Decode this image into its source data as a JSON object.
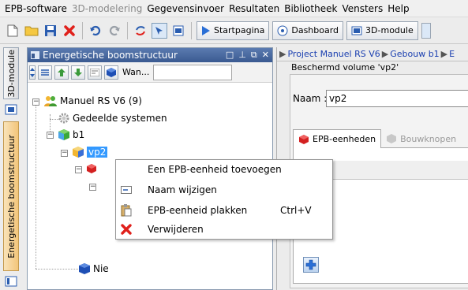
{
  "menubar": {
    "items": [
      {
        "label": "EPB-software"
      },
      {
        "label": "3D-modelering"
      },
      {
        "label": "Gegevensinvoer"
      },
      {
        "label": "Resultaten"
      },
      {
        "label": "Bibliotheek"
      },
      {
        "label": "Vensters"
      },
      {
        "label": "Help"
      }
    ]
  },
  "toolbar": {
    "startpagina_label": "Startpagina",
    "dashboard_label": "Dashboard",
    "module_3d_label": "3D-module"
  },
  "side_tabs": {
    "module_3d": "3D-module",
    "boomstructuur": "Energetische boomstructuur"
  },
  "tree_panel": {
    "title": "Energetische boomstructuur",
    "filter_button_label": "Wan...",
    "nodes": {
      "root": "Manuel RS V6 (9)",
      "systems": "Gedeelde systemen",
      "building": "b1",
      "volume": "vp2",
      "hidden_node": "Nie"
    }
  },
  "right_panel": {
    "breadcrumb": [
      "Project Manuel RS V6",
      "Gebouw b1",
      "E"
    ],
    "volume_title": "Beschermd volume 'vp2'",
    "naam_label": "Naam :",
    "naam_value": "vp2",
    "tabs": [
      {
        "label": "EPB-eenheden"
      },
      {
        "label": "Bouwknopen"
      }
    ]
  },
  "context_menu": {
    "items": [
      {
        "label": "Een EPB-eenheid toevoegen",
        "shortcut": ""
      },
      {
        "label": "Naam wijzigen",
        "shortcut": ""
      },
      {
        "label": "EPB-eenheid plakken",
        "shortcut": "Ctrl+V"
      },
      {
        "label": "Verwijderen",
        "shortcut": ""
      }
    ]
  },
  "colors": {
    "selection": "#3399ff",
    "panel_header": "#3a5a91",
    "active_side_tab": "#f3c57a",
    "delete_red": "#e0201b"
  }
}
